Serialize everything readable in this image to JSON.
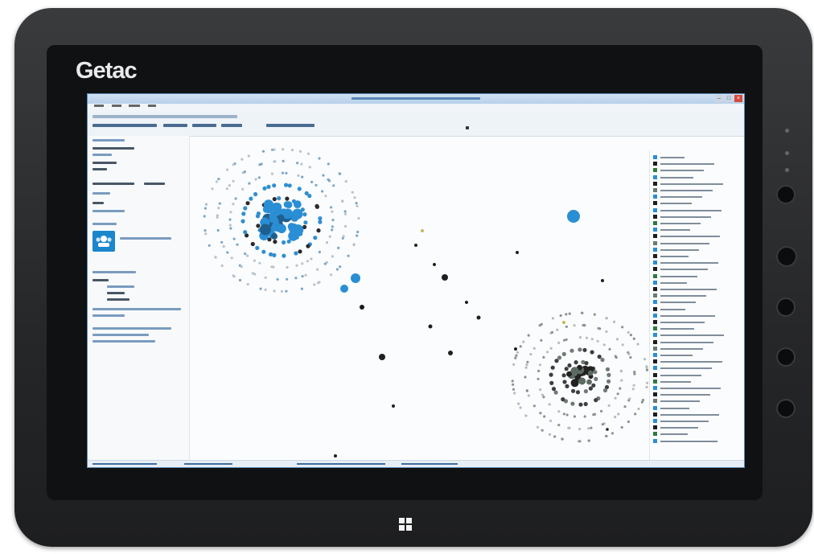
{
  "device": {
    "brand": "Getac",
    "colors": {
      "body": "#2b2c2e",
      "bezel": "#101113",
      "screen_accent": "#1a86cc"
    }
  },
  "screen": {
    "title_bar_icon": "app-icon",
    "window_controls": [
      "minimize-icon",
      "maximize-icon",
      "close-icon"
    ]
  },
  "taskbar_key": "windows-logo-icon"
}
